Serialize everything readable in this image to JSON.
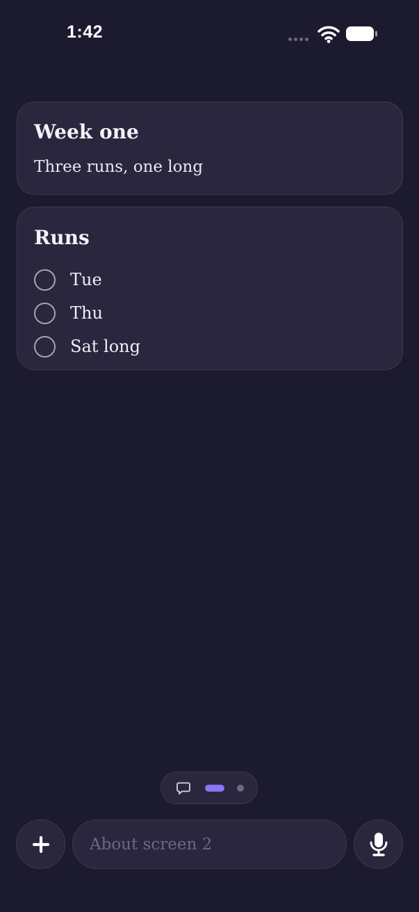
{
  "status_bar": {
    "time": "1:42"
  },
  "cards": {
    "week": {
      "title": "Week one",
      "subtitle": "Three runs, one long"
    },
    "runs": {
      "title": "Runs",
      "items": [
        {
          "label": "Tue",
          "checked": false
        },
        {
          "label": "Thu",
          "checked": false
        },
        {
          "label": "Sat long",
          "checked": false
        }
      ]
    }
  },
  "pager": {
    "icon": "chat-bubble-icon",
    "pages": 2,
    "active_page": 1
  },
  "composer": {
    "placeholder": "About screen 2",
    "value": "",
    "add_icon": "plus-icon",
    "mic_icon": "microphone-icon"
  },
  "colors": {
    "background": "#1c1a2e",
    "card": "#29263d",
    "accent": "#8b73f5"
  }
}
